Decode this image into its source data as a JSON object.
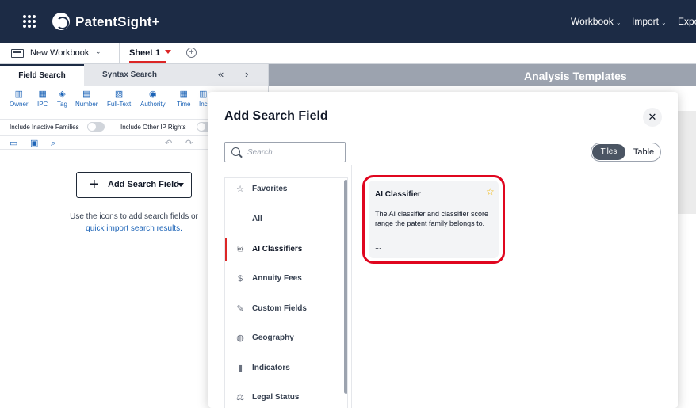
{
  "app": {
    "brand": "PatentSight+",
    "nav": [
      {
        "label": "Workbook",
        "caret": "⌄"
      },
      {
        "label": "Import",
        "caret": "⌄"
      },
      {
        "label": "Expo",
        "caret": ""
      }
    ]
  },
  "workbook": {
    "name": "New Workbook",
    "sheet": "Sheet 1",
    "add_sheet": "+"
  },
  "search_panel": {
    "tabs": [
      "Field Search",
      "Syntax Search"
    ],
    "tab_nav": [
      "«",
      "›"
    ],
    "field_icons": [
      {
        "label": "Owner",
        "glyph": "▥"
      },
      {
        "label": "IPC",
        "glyph": "▦"
      },
      {
        "label": "Tag",
        "glyph": "◈"
      },
      {
        "label": "Number",
        "glyph": "▤"
      },
      {
        "label": "Full-Text",
        "glyph": "▧"
      },
      {
        "label": "Authority",
        "glyph": "◉"
      },
      {
        "label": "Time",
        "glyph": "▦"
      },
      {
        "label": "Inc",
        "glyph": "▥"
      }
    ],
    "toggles": [
      {
        "label": "Include Inactive Families",
        "on": false
      },
      {
        "label": "Include Other IP Rights",
        "on": false
      }
    ],
    "add_button": "Add Search Field",
    "hint_line1": "Use the icons to add search fields or",
    "hint_link": "quick import search results."
  },
  "analysis": {
    "title": "Analysis Templates"
  },
  "modal": {
    "title": "Add Search Field",
    "close": "✕",
    "search_placeholder": "Search",
    "view_options": [
      "Tiles",
      "Table"
    ],
    "active_view": "Tiles",
    "categories": [
      {
        "label": "Favorites",
        "icon": "star-icon",
        "glyph": "☆"
      },
      {
        "label": "All",
        "icon": "",
        "glyph": ""
      },
      {
        "label": "AI Classifiers",
        "icon": "binoculars-icon",
        "glyph": "♾"
      },
      {
        "label": "Annuity Fees",
        "icon": "dollar-icon",
        "glyph": "$"
      },
      {
        "label": "Custom Fields",
        "icon": "pencil-icon",
        "glyph": "✎"
      },
      {
        "label": "Geography",
        "icon": "globe-icon",
        "glyph": "◍"
      },
      {
        "label": "Indicators",
        "icon": "bar-chart-icon",
        "glyph": "▮"
      },
      {
        "label": "Legal Status",
        "icon": "gavel-icon",
        "glyph": "⚖"
      }
    ],
    "active_category": "AI Classifiers",
    "tile": {
      "title": "AI Classifier",
      "description": "The AI classifier and classifier score range the patent family belongs to.",
      "more": "...",
      "star": "☆"
    }
  },
  "colors": {
    "navbar": "#1c2b45",
    "accent_red": "#e0061f",
    "link_blue": "#1d64b7",
    "star": "#f0b400"
  }
}
